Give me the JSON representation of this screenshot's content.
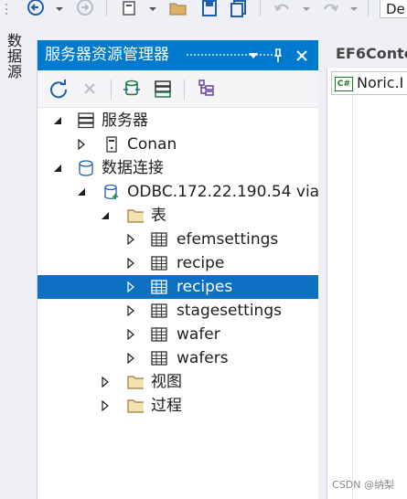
{
  "toolbar": {
    "config_value": "De"
  },
  "side_tab": {
    "label": "数据源"
  },
  "panel": {
    "title": "服务器资源管理器",
    "dropdown_icon": "chevron-down-icon",
    "pin_icon": "pin-icon",
    "close_icon": "close-icon"
  },
  "tree": {
    "nodes": [
      {
        "label": "服务器",
        "icon": "server-icon",
        "expanded": true
      },
      {
        "label": "Conan",
        "icon": "machine-icon",
        "expanded": false
      },
      {
        "label": "数据连接",
        "icon": "database-icon",
        "expanded": true
      },
      {
        "label": "ODBC.172.22.190.54 via",
        "icon": "connection-icon",
        "expanded": true
      },
      {
        "label": "表",
        "icon": "folder-icon",
        "expanded": true
      },
      {
        "label": "efemsettings",
        "icon": "table-icon",
        "expanded": false
      },
      {
        "label": "recipe",
        "icon": "table-icon",
        "expanded": false
      },
      {
        "label": "recipes",
        "icon": "table-icon",
        "expanded": false,
        "selected": true
      },
      {
        "label": "stagesettings",
        "icon": "table-icon",
        "expanded": false
      },
      {
        "label": "wafer",
        "icon": "table-icon",
        "expanded": false
      },
      {
        "label": "wafers",
        "icon": "table-icon",
        "expanded": false
      },
      {
        "label": "视图",
        "icon": "folder-icon",
        "expanded": false
      },
      {
        "label": "过程",
        "icon": "folder-icon",
        "expanded": false
      }
    ]
  },
  "document": {
    "tab_label": "EF6Conte",
    "nav_prefix": "C#",
    "nav_label": "Noric.I"
  },
  "watermark": "CSDN @纳梨",
  "colors": {
    "accent": "#007acc",
    "selection": "#0e70c0"
  }
}
